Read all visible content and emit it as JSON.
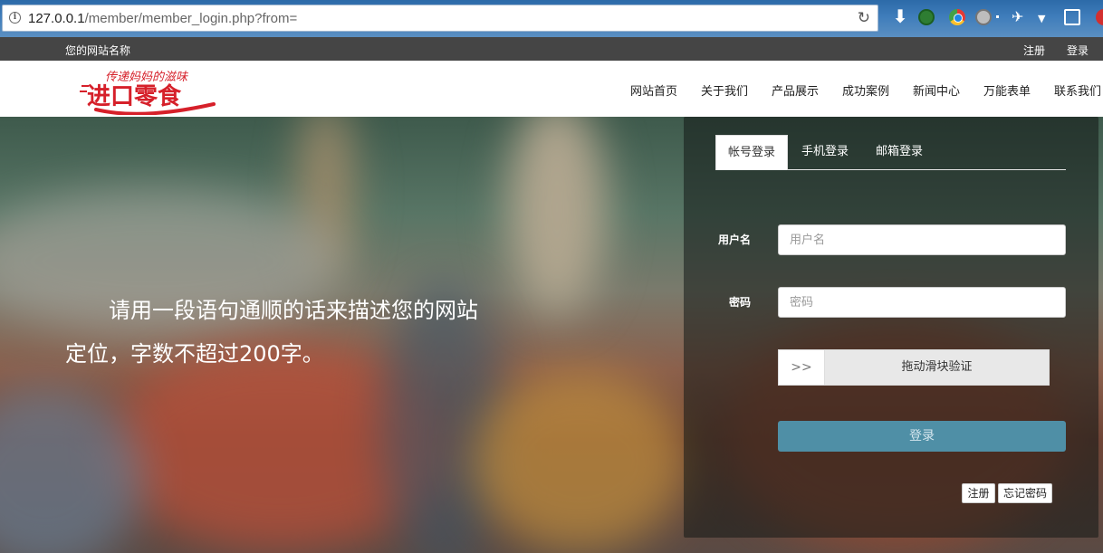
{
  "browser": {
    "url_host": "127.0.0.1",
    "url_path": "/member/member_login.php?from="
  },
  "topbar": {
    "site_name": "您的网站名称",
    "register": "注册",
    "login": "登录"
  },
  "logo": {
    "text_main": "进口零食",
    "text_sub": "传递妈妈的滋味"
  },
  "nav": {
    "items": [
      "网站首页",
      "关于我们",
      "产品展示",
      "成功案例",
      "新闻中心",
      "万能表单",
      "联系我们"
    ]
  },
  "hero": {
    "description": "请用一段语句通顺的话来描述您的网站定位，字数不超过200字。"
  },
  "login_panel": {
    "tabs": [
      "帐号登录",
      "手机登录",
      "邮箱登录"
    ],
    "active_tab": "帐号登录",
    "username_label": "用户名",
    "username_placeholder": "用户名",
    "password_label": "密码",
    "password_placeholder": "密码",
    "slider_handle": ">>",
    "slider_text": "拖动滑块验证",
    "login_button": "登录",
    "register_button": "注册",
    "forgot_button": "忘记密码"
  },
  "colors": {
    "topbar_bg": "#454545",
    "login_button": "#4f8fa6",
    "logo_red": "#d6202a"
  }
}
